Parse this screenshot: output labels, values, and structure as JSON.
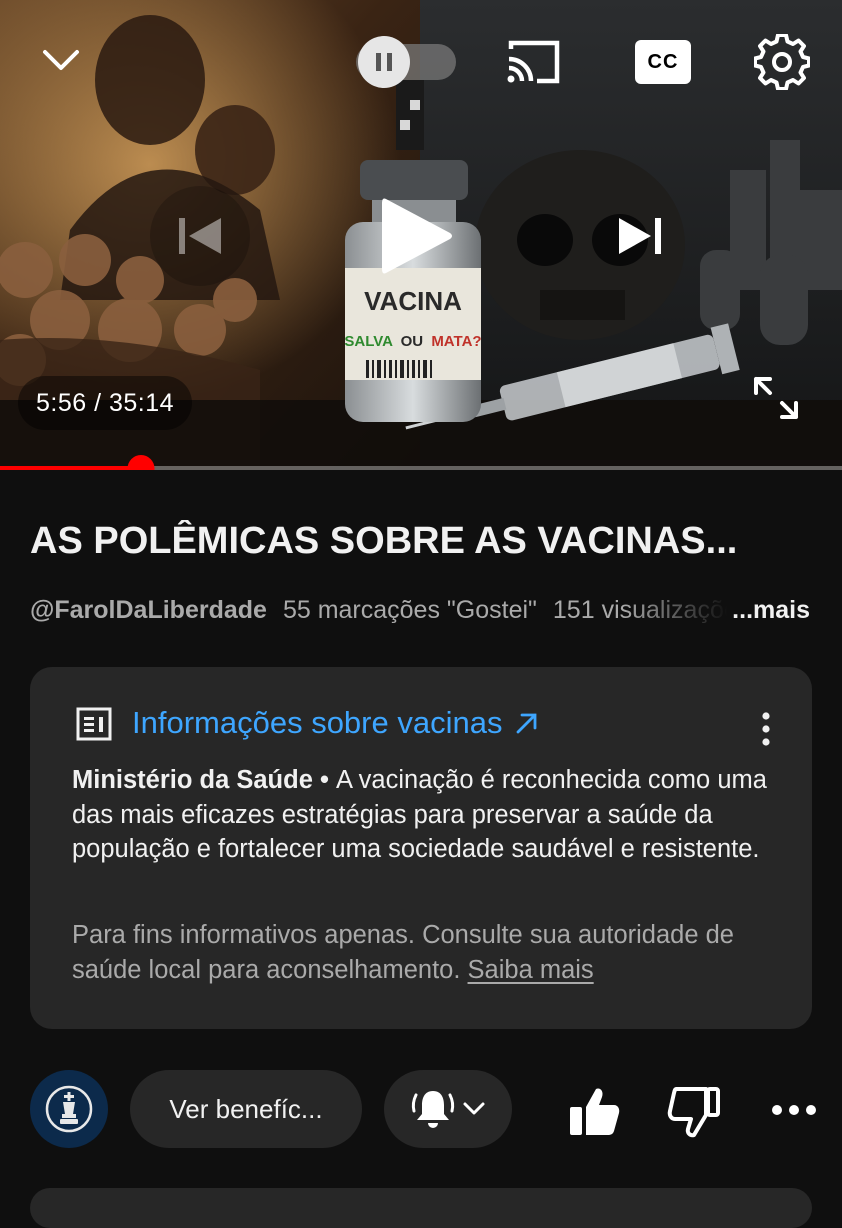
{
  "player": {
    "thumbnail_text": {
      "vial_label": "VACINA",
      "vial_question_a": "SALVA",
      "vial_question_b": "OU",
      "vial_question_c": "MATA?"
    },
    "time": "5:56 / 35:14",
    "progress_fraction": 0.168,
    "cc_label": "CC",
    "icons": [
      "chevron-down-icon",
      "pause-icon",
      "cast-icon",
      "captions-icon",
      "settings-gear-icon",
      "previous-icon",
      "play-icon",
      "next-icon",
      "fullscreen-icon"
    ]
  },
  "video": {
    "title": "AS POLÊMICAS SOBRE AS VACINAS...",
    "channel": "@FarolDaLiberdade",
    "likes": "55 marcações \"Gostei\"",
    "views": "151 visualizações",
    "more": "...mais"
  },
  "info_panel": {
    "title": "Informações sobre vacinas",
    "source": "Ministério da Saúde",
    "bullet": " • ",
    "body": "A vacinação é reconhecida como uma das mais eficazes estratégias para preservar a saúde da população e fortalecer uma sociedade saudável e resistente.",
    "note": "Para fins informativos apenas. Consulte sua autoridade de saúde local para aconselhamento.",
    "learn_more": "Saiba mais",
    "link_color": "#3ea6ff"
  },
  "actions": {
    "benefits_label": "Ver benefíc...",
    "icons": [
      "chess-king-avatar-icon",
      "bell-ringing-icon",
      "chevron-down-icon",
      "like-icon",
      "dislike-icon",
      "more-horizontal-icon"
    ]
  }
}
